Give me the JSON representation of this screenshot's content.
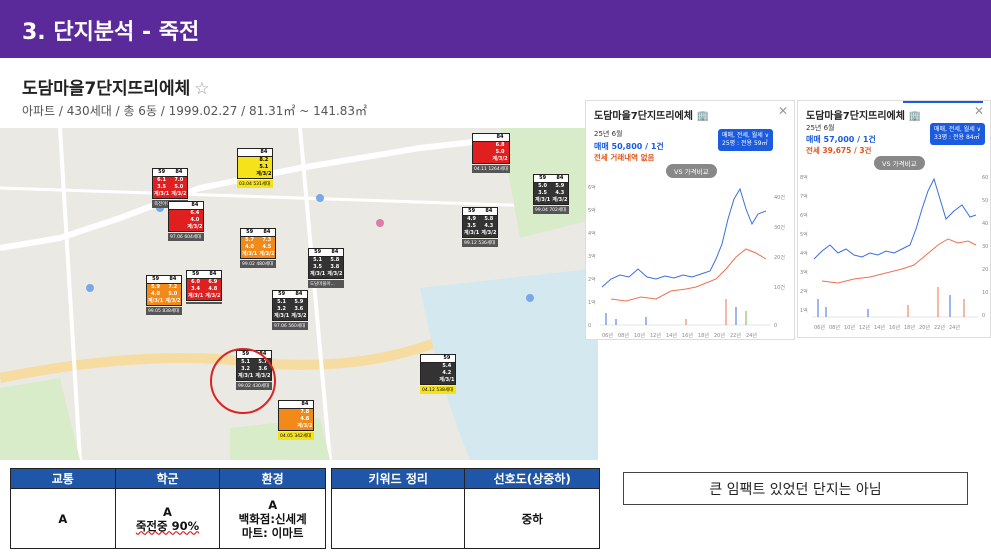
{
  "header": {
    "title": "3. 단지분석 - 죽전",
    "color": "#5b2a9a"
  },
  "complex": {
    "name": "도담마을7단지뜨리에체",
    "star": "☆",
    "info": "아파트 / 430세대 / 총 6동 / 1999.02.27 / 81.31㎡ ~ 141.83㎡"
  },
  "panel1": {
    "title": "도담마을7단지뜨리에체 🏢",
    "close": "✕",
    "date": "25년 6월",
    "sale": "매매 50,800 / 1건",
    "jeonse": "전세 거래내역 없음",
    "filter_line1": "매매, 전세, 월세 ∨",
    "filter_line2": "25평 : 전용 59㎡",
    "vs_button": "VS 가격비교",
    "y_labels_left": [
      "6억",
      "5억",
      "4억",
      "3억",
      "2억",
      "1억",
      "0"
    ],
    "y_labels_right": [
      "40건",
      "30건",
      "20건",
      "10건",
      "0"
    ],
    "x_labels": [
      "06년",
      "08년",
      "10년",
      "12년",
      "14년",
      "16년",
      "18년",
      "20년",
      "22년",
      "24년"
    ]
  },
  "panel2": {
    "title": "도담마을7단지뜨리에체 🏢",
    "close": "✕",
    "date": "25년 6월",
    "sale": "매매 57,000 / 1건",
    "jeonse": "전세 39,675 / 3건",
    "filter_line1": "매매, 전세, 월세 ∨",
    "filter_line2": "33평 : 전용 84㎡",
    "vs_button": "VS 가격비교",
    "y_labels_left": [
      "8억",
      "7억",
      "6억",
      "5억",
      "4억",
      "3억",
      "2억",
      "1억"
    ],
    "y_labels_right": [
      "60",
      "50",
      "40",
      "30",
      "20",
      "10",
      "0"
    ],
    "x_labels": [
      "06년",
      "08년",
      "10년",
      "12년",
      "14년",
      "16년",
      "18년",
      "20년",
      "22년",
      "24년"
    ]
  },
  "table_left": {
    "headers": [
      "교통",
      "학군",
      "환경"
    ],
    "transport": "A",
    "school_grade": "A",
    "school_note": "죽전중 90%",
    "env_grade": "A",
    "env_line1": "백화점:신세계",
    "env_line2": "마트: 이마트"
  },
  "table_right": {
    "headers": [
      "키워드 정리",
      "선호도(상중하)"
    ],
    "keywords": "",
    "preference": "중하"
  },
  "summary": "큰 임팩트 있었던 단지는 아님",
  "map": {
    "markers": [
      {
        "h1": "59",
        "h2": "84",
        "r1a": "6.1",
        "r1b": "7.0",
        "r2a": "3.5",
        "r2b": "5.0",
        "r3a": "계/3/1",
        "r3b": "계/3/2",
        "label": "죽전아이뷰",
        "color": "red"
      },
      {
        "h1": "",
        "h2": "84",
        "r1a": "",
        "r1b": "8.2",
        "r2a": "",
        "r2b": "5.1",
        "r3a": "",
        "r3b": "계/3/2",
        "label": "03.04 531세대",
        "color": "yellow"
      },
      {
        "h1": "",
        "h2": "84",
        "r1a": "",
        "r1b": "6.8",
        "r2a": "",
        "r2b": "5.0",
        "r3a": "",
        "r3b": "계/3/2",
        "label": "04.11 1264세대",
        "color": "red"
      },
      {
        "h1": "59",
        "h2": "84",
        "r1a": "5.0",
        "r1b": "5.9",
        "r2a": "3.5",
        "r2b": "4.3",
        "r3a": "계/3/1",
        "r3b": "계/3/2",
        "label": "99.04 702세대",
        "color": "dark"
      },
      {
        "h1": "59",
        "h2": "84",
        "r1a": "4.9",
        "r1b": "5.8",
        "r2a": "3.5",
        "r2b": "4.3",
        "r3a": "계/3/1",
        "r3b": "계/3/2",
        "label": "99.12 536세대",
        "color": "dark"
      },
      {
        "h1": "",
        "h2": "84",
        "r1a": "",
        "r1b": "6.4",
        "r2a": "",
        "r2b": "4.0",
        "r3a": "",
        "r3b": "계/3/2",
        "label": "97.06 604세대",
        "color": "red"
      },
      {
        "h1": "59",
        "h2": "84",
        "r1a": "5.7",
        "r1b": "7.3",
        "r2a": "4.0",
        "r2b": "4.5",
        "r3a": "계/3/1",
        "r3b": "계/3/2",
        "label": "99.02 480세대",
        "color": "orange"
      },
      {
        "h1": "59",
        "h2": "84",
        "r1a": "5.1",
        "r1b": "5.8",
        "r2a": "3.5",
        "r2b": "3.8",
        "r3a": "계/3/1",
        "r3b": "계/3/2",
        "label": "도담마을아...",
        "color": "dark"
      },
      {
        "h1": "59",
        "h2": "84",
        "r1a": "6.0",
        "r1b": "6.9",
        "r2a": "3.4",
        "r2b": "4.8",
        "r3a": "계/3/1",
        "r3b": "계/3/2",
        "label": "",
        "color": "red"
      },
      {
        "h1": "59",
        "h2": "84",
        "r1a": "5.9",
        "r1b": "7.2",
        "r2a": "4.0",
        "r2b": "5.0",
        "r3a": "계/3/1",
        "r3b": "계/3/2",
        "label": "99.05 838세대",
        "color": "orange"
      },
      {
        "h1": "59",
        "h2": "84",
        "r1a": "5.1",
        "r1b": "5.9",
        "r2a": "3.2",
        "r2b": "3.6",
        "r3a": "계/3/1",
        "r3b": "계/3/2",
        "label": "97.06 560세대",
        "color": "dark"
      },
      {
        "h1": "59",
        "h2": "84",
        "r1a": "5.1",
        "r1b": "5.7",
        "r2a": "3.2",
        "r2b": "3.6",
        "r3a": "계/3/1",
        "r3b": "계/3/2",
        "label": "99.02 430세대",
        "color": "dark"
      },
      {
        "h1": "",
        "h2": "59",
        "r1a": "",
        "r1b": "5.4",
        "r2a": "",
        "r2b": "4.2",
        "r3a": "",
        "r3b": "계/3/1",
        "label": "04.12 538세대",
        "color": "dark"
      },
      {
        "h1": "",
        "h2": "84",
        "r1a": "",
        "r1b": "7.8",
        "r2a": "",
        "r2b": "4.8",
        "r3a": "",
        "r3b": "계/3/2",
        "label": "04.05 342세대",
        "color": "orange"
      }
    ]
  }
}
